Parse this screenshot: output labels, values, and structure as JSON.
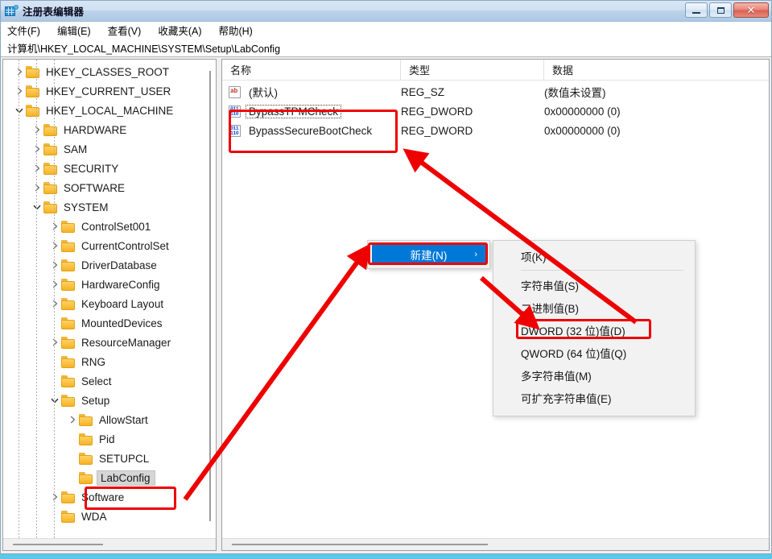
{
  "window": {
    "title": "注册表编辑器",
    "icon": "registry-grid-icon",
    "controls": {
      "minimize": "–",
      "maximize": "❐",
      "close": "✕"
    }
  },
  "menubar": {
    "items": [
      {
        "label": "文件(F)"
      },
      {
        "label": "编辑(E)"
      },
      {
        "label": "查看(V)"
      },
      {
        "label": "收藏夹(A)"
      },
      {
        "label": "帮助(H)"
      }
    ]
  },
  "addressbar": {
    "path": "计算机\\HKEY_LOCAL_MACHINE\\SYSTEM\\Setup\\LabConfig"
  },
  "tree": {
    "nodes": [
      {
        "label": "HKEY_CLASSES_ROOT",
        "depth": 1,
        "state": "collapsed",
        "selected": false
      },
      {
        "label": "HKEY_CURRENT_USER",
        "depth": 1,
        "state": "collapsed",
        "selected": false
      },
      {
        "label": "HKEY_LOCAL_MACHINE",
        "depth": 1,
        "state": "expanded",
        "selected": false
      },
      {
        "label": "HARDWARE",
        "depth": 2,
        "state": "collapsed",
        "selected": false
      },
      {
        "label": "SAM",
        "depth": 2,
        "state": "collapsed",
        "selected": false
      },
      {
        "label": "SECURITY",
        "depth": 2,
        "state": "collapsed",
        "selected": false
      },
      {
        "label": "SOFTWARE",
        "depth": 2,
        "state": "collapsed",
        "selected": false
      },
      {
        "label": "SYSTEM",
        "depth": 2,
        "state": "expanded",
        "selected": false
      },
      {
        "label": "ControlSet001",
        "depth": 3,
        "state": "collapsed",
        "selected": false
      },
      {
        "label": "CurrentControlSet",
        "depth": 3,
        "state": "collapsed",
        "selected": false
      },
      {
        "label": "DriverDatabase",
        "depth": 3,
        "state": "collapsed",
        "selected": false
      },
      {
        "label": "HardwareConfig",
        "depth": 3,
        "state": "collapsed",
        "selected": false
      },
      {
        "label": "Keyboard Layout",
        "depth": 3,
        "state": "collapsed",
        "selected": false
      },
      {
        "label": "MountedDevices",
        "depth": 3,
        "state": "leaf",
        "selected": false
      },
      {
        "label": "ResourceManager",
        "depth": 3,
        "state": "collapsed",
        "selected": false
      },
      {
        "label": "RNG",
        "depth": 3,
        "state": "leaf",
        "selected": false
      },
      {
        "label": "Select",
        "depth": 3,
        "state": "leaf",
        "selected": false
      },
      {
        "label": "Setup",
        "depth": 3,
        "state": "expanded",
        "selected": false
      },
      {
        "label": "AllowStart",
        "depth": 4,
        "state": "collapsed",
        "selected": false
      },
      {
        "label": "Pid",
        "depth": 4,
        "state": "leaf",
        "selected": false
      },
      {
        "label": "SETUPCL",
        "depth": 4,
        "state": "leaf",
        "selected": false
      },
      {
        "label": "LabConfig",
        "depth": 4,
        "state": "leaf",
        "selected": true
      },
      {
        "label": "Software",
        "depth": 3,
        "state": "collapsed",
        "selected": false
      },
      {
        "label": "WDA",
        "depth": 3,
        "state": "leaf",
        "selected": false
      }
    ]
  },
  "list": {
    "columns": [
      "名称",
      "类型",
      "数据"
    ],
    "rows": [
      {
        "icon": "string-value-icon",
        "name": "(默认)",
        "type": "REG_SZ",
        "data": "(数值未设置)",
        "focused": false,
        "highlighted": false
      },
      {
        "icon": "dword-value-icon",
        "name": "BypassTPMCheck",
        "type": "REG_DWORD",
        "data": "0x00000000 (0)",
        "focused": true,
        "highlighted": true
      },
      {
        "icon": "dword-value-icon",
        "name": "BypassSecureBootCheck",
        "type": "REG_DWORD",
        "data": "0x00000000 (0)",
        "focused": false,
        "highlighted": true
      }
    ]
  },
  "context_menu": {
    "root_item": {
      "label": "新建(N)",
      "submenu_arrow": "›",
      "highlighted": true
    },
    "submenu": [
      {
        "label": "项(K)",
        "separator_after": true
      },
      {
        "label": "字符串值(S)",
        "separator_after": false
      },
      {
        "label": "二进制值(B)",
        "separator_after": false
      },
      {
        "label": "DWORD (32 位)值(D)",
        "separator_after": false,
        "annotated": true
      },
      {
        "label": "QWORD (64 位)值(Q)",
        "separator_after": false
      },
      {
        "label": "多字符串值(M)",
        "separator_after": false
      },
      {
        "label": "可扩充字符串值(E)",
        "separator_after": false
      }
    ]
  },
  "annotations": {
    "color": "#ee0000",
    "boxes": [
      {
        "name": "values-highlight-box"
      },
      {
        "name": "labconfig-highlight-box"
      },
      {
        "name": "new-menu-highlight-box"
      },
      {
        "name": "dword-item-highlight-box"
      }
    ],
    "arrows": [
      {
        "name": "arrow-labconfig-to-new"
      },
      {
        "name": "arrow-binary-to-dword"
      },
      {
        "name": "arrow-dword-to-values"
      }
    ]
  },
  "colors": {
    "accent_blue": "#0078d7",
    "annotation_red": "#ee0000",
    "folder_yellow": "#fcc13f",
    "titlebar_blue": "#bcd3ea"
  }
}
